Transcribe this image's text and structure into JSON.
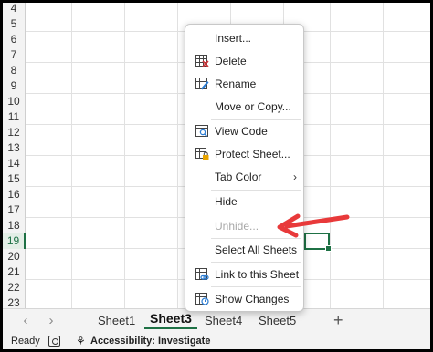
{
  "grid": {
    "row_numbers": [
      "4",
      "5",
      "6",
      "7",
      "8",
      "9",
      "10",
      "11",
      "12",
      "13",
      "14",
      "15",
      "16",
      "17",
      "18",
      "19",
      "20",
      "21",
      "22",
      "23"
    ],
    "selected_row": "19"
  },
  "context_menu": {
    "items": [
      {
        "label": "Insert...",
        "icon": "none",
        "disabled": false
      },
      {
        "label": "Delete",
        "icon": "delete-sheet-icon",
        "disabled": false
      },
      {
        "label": "Rename",
        "icon": "rename-icon",
        "disabled": false
      },
      {
        "label": "Move or Copy...",
        "icon": "none",
        "disabled": false
      },
      {
        "label": "View Code",
        "icon": "view-code-icon",
        "disabled": false
      },
      {
        "label": "Protect Sheet...",
        "icon": "protect-sheet-icon",
        "disabled": false
      },
      {
        "label": "Tab Color",
        "icon": "none",
        "disabled": false
      },
      {
        "label": "Hide",
        "icon": "none",
        "disabled": false
      },
      {
        "label": "Unhide...",
        "icon": "none",
        "disabled": true
      },
      {
        "label": "Select All Sheets",
        "icon": "none",
        "disabled": false
      },
      {
        "label": "Link to this Sheet",
        "icon": "link-icon",
        "disabled": false
      },
      {
        "label": "Show Changes",
        "icon": "show-changes-icon",
        "disabled": false
      }
    ],
    "submenu_chevron": "›"
  },
  "sheet_tabs": {
    "prev": "‹",
    "next": "›",
    "tabs": [
      "Sheet1",
      "Sheet3",
      "Sheet4",
      "Sheet5"
    ],
    "active": "Sheet3",
    "add": "+"
  },
  "status_bar": {
    "ready": "Ready",
    "accessibility": "Accessibility: Investigate"
  },
  "colors": {
    "excel_green": "#1e7145",
    "arrow_red": "#e8393a"
  }
}
